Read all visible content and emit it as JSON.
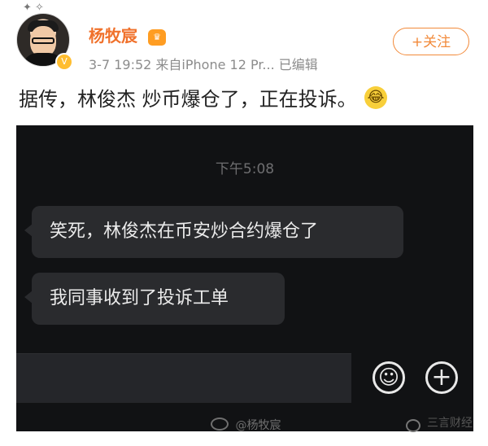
{
  "post": {
    "author": "杨牧宸",
    "meta": "3-7 19:52  来自iPhone 12 Pr...  已编辑",
    "follow_label": "+关注",
    "text": "据传，林俊杰 炒币爆仓了，正在投诉。",
    "crown_badge": "crown-icon",
    "verified_badge": "verified-icon",
    "emoji": "laugh-cry-emoji"
  },
  "chat": {
    "time": "下午5:08",
    "messages": [
      {
        "text": "笑死，林俊杰在币安炒合约爆仓了"
      },
      {
        "text": "我同事收到了投诉工单"
      }
    ],
    "emoji_icon": "emoji-icon",
    "plus_icon": "plus-icon"
  },
  "footer": {
    "watermark": "@杨牧宸",
    "brand": "三言财经"
  },
  "colors": {
    "accent": "#f28a3a",
    "author": "#f0712b",
    "chat_background": "#111214"
  }
}
